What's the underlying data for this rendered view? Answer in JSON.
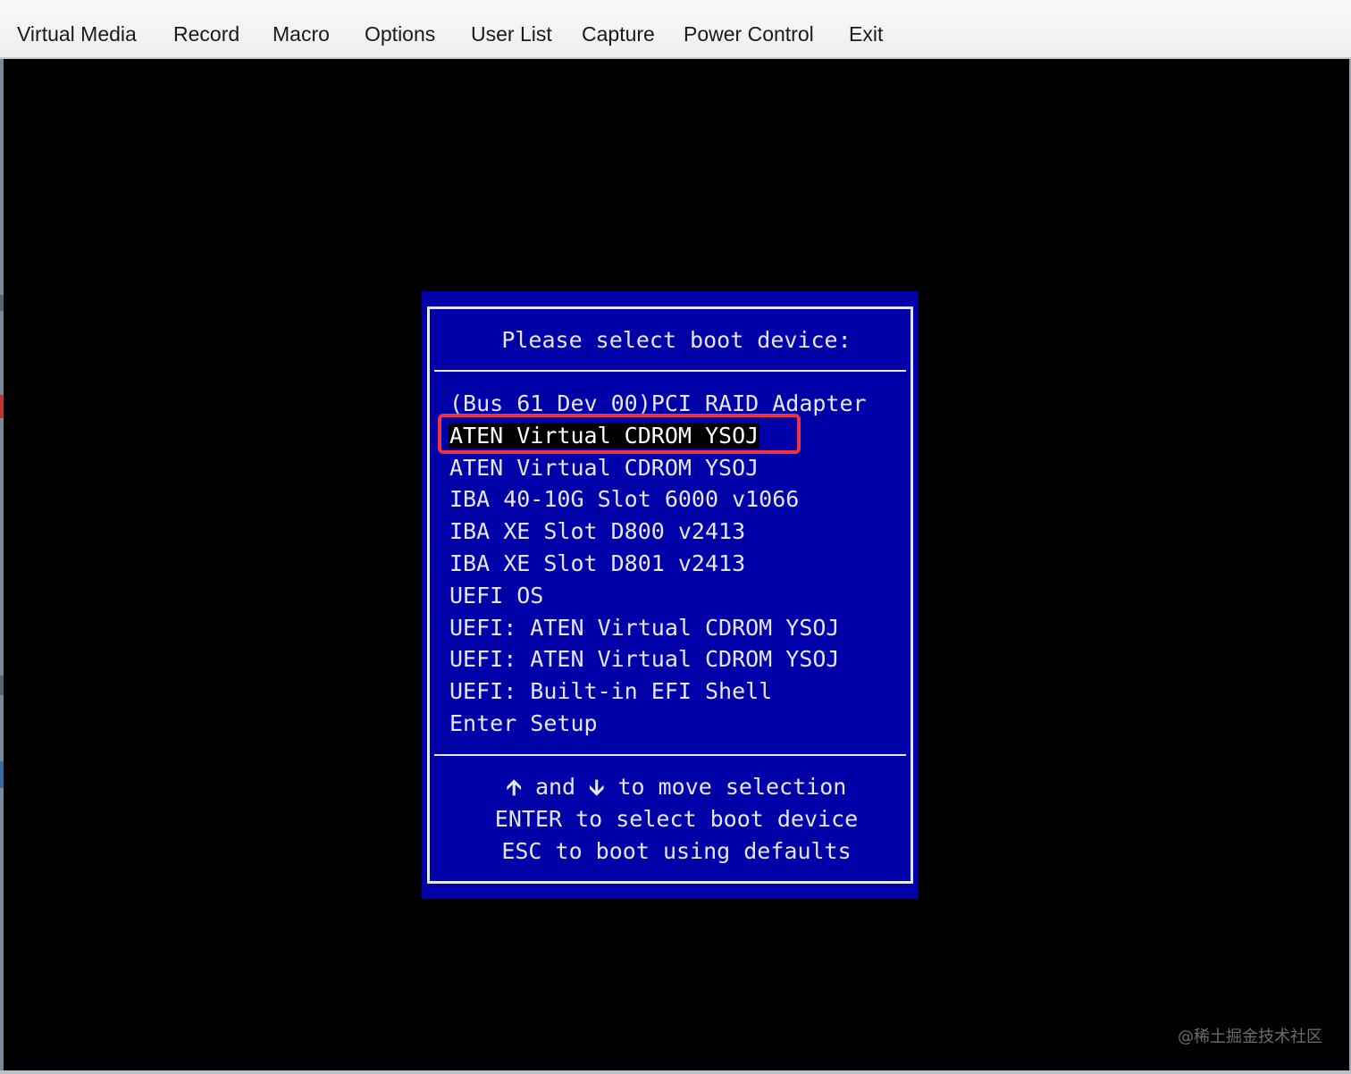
{
  "menubar": {
    "items": [
      {
        "label": "Virtual Media"
      },
      {
        "label": "Record"
      },
      {
        "label": "Macro"
      },
      {
        "label": "Options"
      },
      {
        "label": "User List"
      },
      {
        "label": "Capture"
      },
      {
        "label": "Power Control"
      },
      {
        "label": "Exit"
      }
    ]
  },
  "boot_menu": {
    "title": "Please select boot device:",
    "devices": [
      {
        "label": "(Bus 61 Dev 00)PCI RAID Adapter",
        "selected": false
      },
      {
        "label": "ATEN Virtual CDROM YSOJ",
        "selected": true
      },
      {
        "label": "ATEN Virtual CDROM YSOJ",
        "selected": false
      },
      {
        "label": "IBA 40-10G Slot 6000 v1066",
        "selected": false
      },
      {
        "label": "IBA XE Slot D800 v2413",
        "selected": false
      },
      {
        "label": "IBA XE Slot D801 v2413",
        "selected": false
      },
      {
        "label": "UEFI OS",
        "selected": false
      },
      {
        "label": "UEFI: ATEN Virtual CDROM YSOJ",
        "selected": false
      },
      {
        "label": "UEFI: ATEN Virtual CDROM YSOJ",
        "selected": false
      },
      {
        "label": "UEFI: Built-in EFI Shell",
        "selected": false
      },
      {
        "label": "Enter Setup",
        "selected": false
      }
    ],
    "help": {
      "up_arrow_icon": "up-arrow-icon",
      "and_text": " and ",
      "down_arrow_icon": "down-arrow-icon",
      "move_text": " to move selection",
      "enter_line": "ENTER to select boot device",
      "esc_line": "ESC to boot using defaults"
    }
  },
  "annotation": {
    "color": "#ee3344"
  },
  "watermark": "@稀土掘金技术社区",
  "colors": {
    "bios_blue": "#0000a8",
    "menubar_bg": "#f2f2f2",
    "screen_bg": "#000000"
  }
}
